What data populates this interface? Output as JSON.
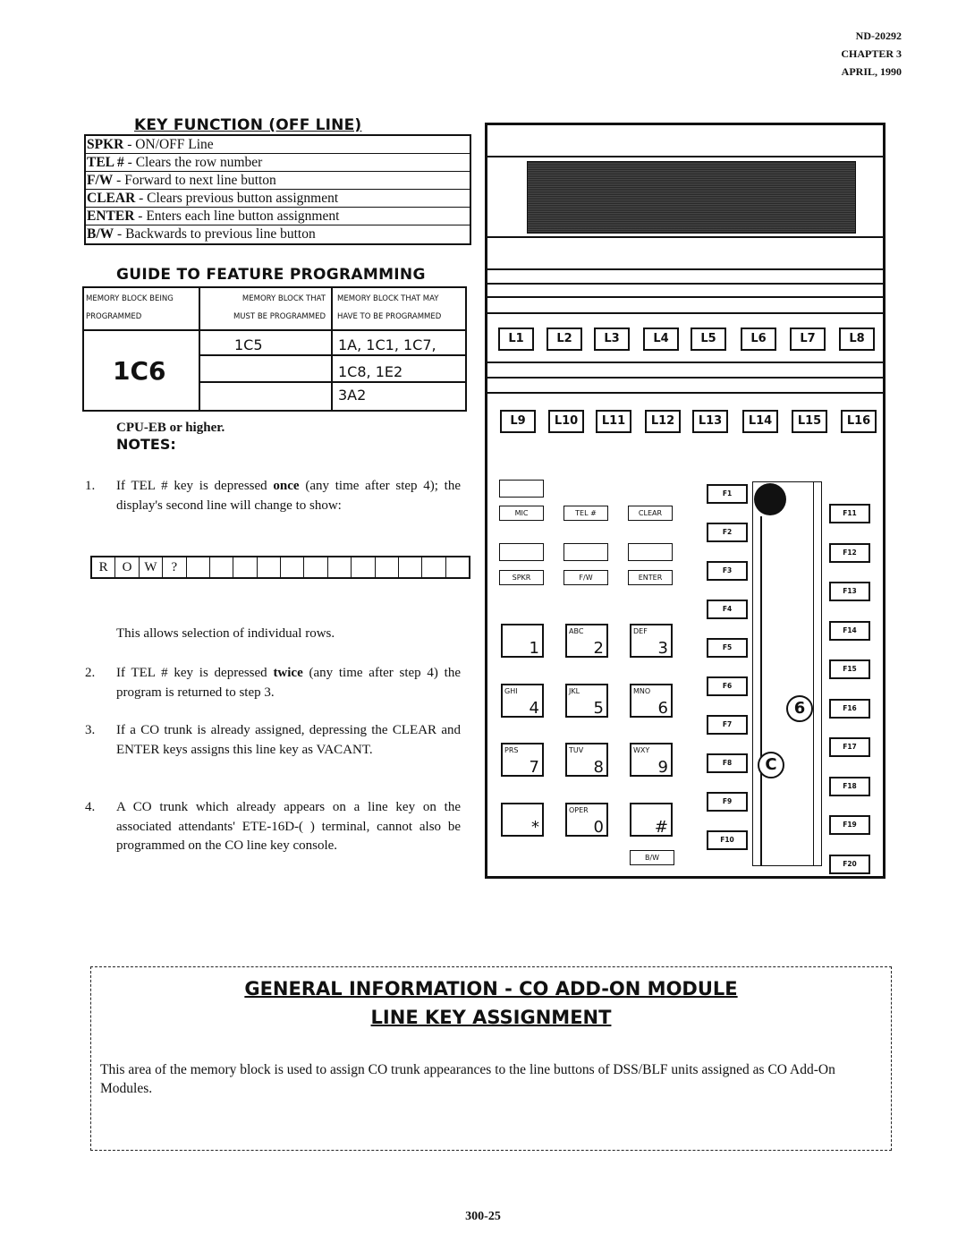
{
  "header": {
    "doc_number": "ND-20292",
    "chapter": "CHAPTER 3",
    "date": "APRIL, 1990"
  },
  "key_function": {
    "title": "KEY FUNCTION (OFF LINE)",
    "rows": [
      {
        "key": "SPKR",
        "desc": " - ON/OFF Line"
      },
      {
        "key": "TEL #",
        "desc": " - Clears the row number"
      },
      {
        "key": "F/W",
        "desc": " - Forward to next line button"
      },
      {
        "key": "CLEAR",
        "desc": " - Clears previous button assignment"
      },
      {
        "key": "ENTER",
        "desc": " - Enters each line button assignment"
      },
      {
        "key": "B/W",
        "desc": " - Backwards to previous line button"
      }
    ]
  },
  "guide": {
    "title": "GUIDE TO FEATURE PROGRAMMING",
    "headers": [
      [
        "MEMORY BLOCK BEING",
        "PROGRAMMED"
      ],
      [
        "MEMORY BLOCK THAT",
        "MUST BE PROGRAMMED"
      ],
      [
        "MEMORY BLOCK THAT MAY",
        "HAVE TO BE PROGRAMMED"
      ]
    ],
    "being_programmed": "1C6",
    "must_be": [
      "1C5",
      "",
      ""
    ],
    "may_have": [
      "1A, 1C1, 1C7,",
      "1C8, 1E2",
      "3A2"
    ]
  },
  "cpu_note": "CPU-EB or higher.",
  "notes_title": "NOTES:",
  "notes": {
    "n1": {
      "num": "1.",
      "pre": "If TEL # key is depressed ",
      "bold": "once",
      "post": " (any time after step 4); the display's second line will change to show:"
    },
    "row_display": [
      "R",
      "O",
      "W",
      "?",
      "",
      "",
      "",
      "",
      "",
      "",
      "",
      "",
      "",
      "",
      "",
      ""
    ],
    "row_caption": "This allows selection of individual rows.",
    "n2": {
      "num": "2.",
      "pre": "If TEL # key is depressed ",
      "bold": "twice",
      "post": " (any time after step 4) the program is returned to step 3."
    },
    "n3": {
      "num": "3.",
      "text": "If a CO trunk is already assigned, depressing the CLEAR and ENTER keys assigns this line key as VACANT."
    },
    "n4": {
      "num": "4.",
      "text": "A CO trunk which already appears on a line key on the associated attendants' ETE-16D-( ) terminal, cannot also be programmed on the CO line key console."
    }
  },
  "phone": {
    "line_keys_row1": [
      "L1",
      "L2",
      "L3",
      "L4",
      "L5",
      "L6",
      "L7",
      "L8"
    ],
    "line_keys_row2": [
      "L9",
      "L10",
      "L11",
      "L12",
      "L13",
      "L14",
      "L15",
      "L16"
    ],
    "soft_keys": [
      "MIC",
      "TEL #",
      "CLEAR",
      "SPKR",
      "F/W",
      "ENTER"
    ],
    "dial_keys": [
      {
        "sub": "",
        "digit": "1"
      },
      {
        "sub": "ABC",
        "digit": "2"
      },
      {
        "sub": "DEF",
        "digit": "3"
      },
      {
        "sub": "GHI",
        "digit": "4"
      },
      {
        "sub": "JKL",
        "digit": "5"
      },
      {
        "sub": "MNO",
        "digit": "6"
      },
      {
        "sub": "PRS",
        "digit": "7"
      },
      {
        "sub": "TUV",
        "digit": "8"
      },
      {
        "sub": "WXY",
        "digit": "9"
      },
      {
        "sub": "",
        "digit": "*"
      },
      {
        "sub": "OPER",
        "digit": "0"
      },
      {
        "sub": "",
        "digit": "#"
      }
    ],
    "bw_key": "B/W",
    "f_keys_left": [
      "F1",
      "F2",
      "F3",
      "F4",
      "F5",
      "F6",
      "F7",
      "F8",
      "F9",
      "F10"
    ],
    "f_keys_right": [
      "F11",
      "F12",
      "F13",
      "F14",
      "F15",
      "F16",
      "F17",
      "F18",
      "F19",
      "F20"
    ],
    "callout_6": "6",
    "callout_c": "C"
  },
  "info_box": {
    "title1": "GENERAL  INFORMATION  -  CO ADD-ON MODULE",
    "title2": "LINE KEY ASSIGNMENT",
    "body": "This area of the memory block is used to assign CO trunk appearances to the line buttons of DSS/BLF units assigned as CO Add-On Modules."
  },
  "footer": {
    "page": "300-25"
  }
}
